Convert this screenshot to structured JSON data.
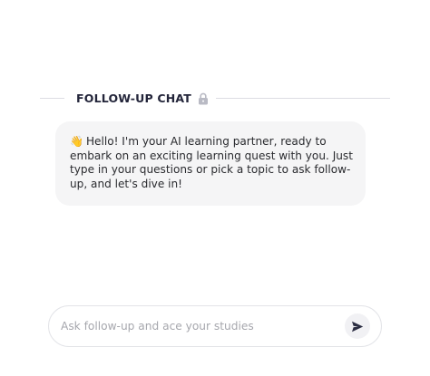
{
  "section": {
    "title": "FOLLOW-UP CHAT",
    "icon": "lock-icon"
  },
  "chat": {
    "messages": [
      {
        "role": "assistant",
        "emoji": "👋",
        "text": "Hello!  I'm your AI learning partner, ready to embark on an exciting learning quest with you. Just type in your questions or pick a topic to ask follow-up, and let's dive in!"
      }
    ]
  },
  "input": {
    "placeholder": "Ask follow-up and ace your studies",
    "value": "",
    "send_icon": "send-icon"
  },
  "colors": {
    "bubble_bg": "#f5f5f6",
    "title": "#23253a",
    "placeholder": "#a6a7ad",
    "send_icon": "#2b2d42"
  }
}
